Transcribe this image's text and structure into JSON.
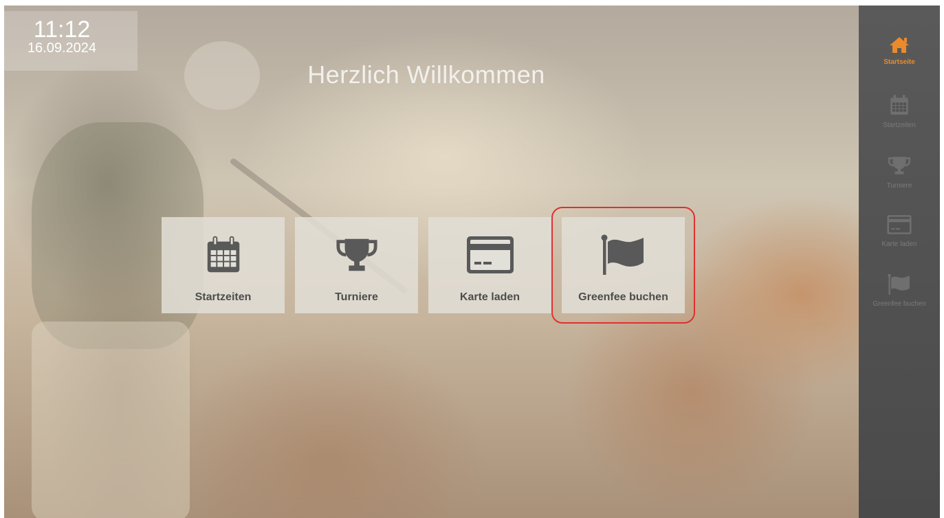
{
  "clock": {
    "time": "11:12",
    "date": "16.09.2024"
  },
  "welcome": "Herzlich Willkommen",
  "tiles": [
    {
      "label": "Startzeiten",
      "icon": "calendar-icon"
    },
    {
      "label": "Turniere",
      "icon": "trophy-icon"
    },
    {
      "label": "Karte laden",
      "icon": "card-icon"
    },
    {
      "label": "Greenfee buchen",
      "icon": "flag-icon",
      "highlighted": true
    }
  ],
  "sidebar": {
    "items": [
      {
        "label": "Startseite",
        "icon": "home-icon",
        "active": true
      },
      {
        "label": "Startzeiten",
        "icon": "calendar-icon"
      },
      {
        "label": "Turniere",
        "icon": "trophy-icon"
      },
      {
        "label": "Karte laden",
        "icon": "card-icon"
      },
      {
        "label": "Greenfee buchen",
        "icon": "flag-icon"
      }
    ]
  },
  "colors": {
    "accent": "#e98a2c",
    "highlight_border": "#e03030",
    "tile_text": "#4d4d4d"
  }
}
